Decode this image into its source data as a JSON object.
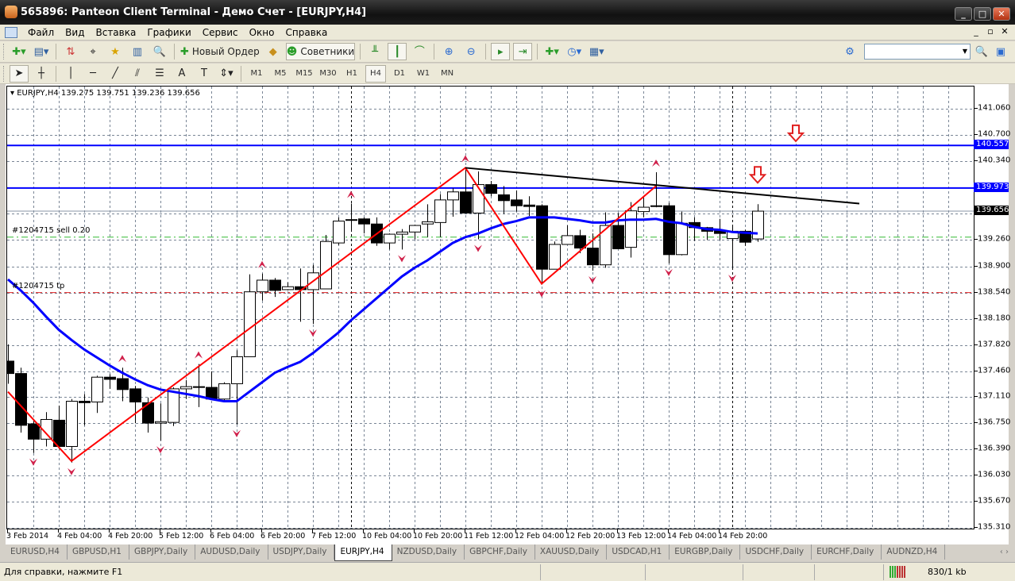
{
  "window": {
    "title": "565896: Panteon Client Terminal - Демо Счет - [EURJPY,H4]",
    "buttons": [
      "_",
      "□",
      "✕"
    ]
  },
  "menu": [
    "Файл",
    "Вид",
    "Вставка",
    "Графики",
    "Сервис",
    "Окно",
    "Справка"
  ],
  "mdi_buttons": [
    "_",
    "▫",
    "✕"
  ],
  "toolbar": {
    "new_order": "Новый Ордер",
    "experts": "Советники",
    "search_value": ""
  },
  "timeframes": [
    "M1",
    "M5",
    "M15",
    "M30",
    "H1",
    "H4",
    "D1",
    "W1",
    "MN"
  ],
  "active_timeframe": "H4",
  "chart": {
    "header": "EURJPY,H4  139.275 139.751 139.236 139.656",
    "order_label": "#1204715 sell 0.20",
    "tp_label": "#1204715 tp",
    "colors": {
      "bull": "#ffffff",
      "bear": "#000000",
      "ma": "#0000ff",
      "zigzag": "#ff0000",
      "level": "#0000ff",
      "fractal": "#d0204a"
    }
  },
  "chart_data": {
    "type": "candlestick",
    "symbol": "EURJPY",
    "timeframe": "H4",
    "ylim": [
      135.27,
      141.4
    ],
    "price_ticks": [
      "141.060",
      "140.700",
      "140.340",
      "139.260",
      "138.900",
      "138.540",
      "138.180",
      "137.820",
      "137.460",
      "137.110",
      "136.750",
      "136.390",
      "136.030",
      "135.670",
      "135.310"
    ],
    "grid_prices": [
      141.06,
      140.7,
      140.34,
      139.98,
      139.62,
      139.26,
      138.9,
      138.54,
      138.18,
      137.82,
      137.46,
      137.11,
      136.75,
      136.39,
      136.03,
      135.67,
      135.31
    ],
    "time_labels": [
      {
        "i": 0,
        "label": "3 Feb 2014"
      },
      {
        "i": 4,
        "label": "4 Feb 04:00"
      },
      {
        "i": 8,
        "label": "4 Feb 20:00"
      },
      {
        "i": 12,
        "label": "5 Feb 12:00"
      },
      {
        "i": 16,
        "label": "6 Feb 04:00"
      },
      {
        "i": 20,
        "label": "6 Feb 20:00"
      },
      {
        "i": 24,
        "label": "7 Feb 12:00"
      },
      {
        "i": 28,
        "label": "10 Feb 04:00"
      },
      {
        "i": 32,
        "label": "10 Feb 20:00"
      },
      {
        "i": 36,
        "label": "11 Feb 12:00"
      },
      {
        "i": 40,
        "label": "12 Feb 04:00"
      },
      {
        "i": 44,
        "label": "12 Feb 20:00"
      },
      {
        "i": 48,
        "label": "13 Feb 12:00"
      },
      {
        "i": 52,
        "label": "14 Feb 04:00"
      },
      {
        "i": 56,
        "label": "14 Feb 20:00"
      }
    ],
    "ohlc": [
      [
        137.6,
        137.83,
        137.29,
        137.43
      ],
      [
        137.43,
        137.51,
        136.62,
        136.72
      ],
      [
        136.74,
        136.8,
        136.34,
        136.53
      ],
      [
        136.53,
        136.9,
        136.43,
        136.8
      ],
      [
        136.79,
        136.99,
        136.42,
        136.43
      ],
      [
        136.43,
        137.08,
        136.21,
        137.05
      ],
      [
        137.05,
        137.15,
        136.72,
        137.03
      ],
      [
        137.04,
        137.4,
        136.89,
        137.38
      ],
      [
        137.38,
        137.42,
        137.22,
        137.35
      ],
      [
        137.36,
        137.51,
        137.05,
        137.21
      ],
      [
        137.22,
        137.26,
        136.75,
        137.04
      ],
      [
        137.03,
        137.1,
        136.62,
        136.75
      ],
      [
        136.75,
        137.02,
        136.51,
        136.77
      ],
      [
        136.76,
        137.24,
        136.71,
        137.22
      ],
      [
        137.22,
        137.34,
        137.08,
        137.25
      ],
      [
        137.25,
        137.56,
        136.97,
        137.24
      ],
      [
        137.24,
        137.46,
        137.08,
        137.08
      ],
      [
        137.08,
        137.31,
        137.05,
        137.29
      ],
      [
        137.29,
        137.75,
        136.73,
        137.66
      ],
      [
        137.66,
        138.79,
        137.66,
        138.55
      ],
      [
        138.55,
        138.8,
        138.43,
        138.71
      ],
      [
        138.71,
        138.74,
        138.48,
        138.57
      ],
      [
        138.58,
        138.68,
        138.57,
        138.62
      ],
      [
        138.62,
        138.87,
        138.14,
        138.58
      ],
      [
        138.58,
        138.92,
        138.11,
        138.81
      ],
      [
        138.59,
        139.33,
        138.59,
        139.24
      ],
      [
        139.22,
        139.57,
        139.19,
        139.52
      ],
      [
        139.54,
        139.76,
        139.4,
        139.54
      ],
      [
        139.55,
        139.57,
        139.35,
        139.48
      ],
      [
        139.48,
        139.57,
        139.18,
        139.22
      ],
      [
        139.22,
        139.35,
        139.13,
        139.34
      ],
      [
        139.34,
        139.41,
        139.13,
        139.37
      ],
      [
        139.37,
        139.47,
        139.27,
        139.46
      ],
      [
        139.48,
        139.75,
        139.3,
        139.51
      ],
      [
        139.5,
        139.89,
        139.3,
        139.81
      ],
      [
        139.81,
        139.97,
        139.58,
        139.92
      ],
      [
        139.92,
        140.25,
        139.63,
        139.63
      ],
      [
        139.63,
        140.2,
        139.27,
        140.02
      ],
      [
        140.02,
        140.07,
        139.86,
        139.9
      ],
      [
        139.88,
        140.0,
        139.62,
        139.8
      ],
      [
        139.81,
        139.94,
        139.65,
        139.73
      ],
      [
        139.74,
        139.86,
        139.59,
        139.72
      ],
      [
        139.73,
        139.75,
        138.65,
        138.86
      ],
      [
        138.86,
        139.24,
        138.86,
        139.2
      ],
      [
        139.2,
        139.46,
        139.2,
        139.32
      ],
      [
        139.32,
        139.4,
        139.08,
        139.15
      ],
      [
        139.15,
        139.35,
        138.84,
        138.92
      ],
      [
        138.92,
        139.64,
        138.88,
        139.46
      ],
      [
        139.46,
        139.63,
        139.14,
        139.14
      ],
      [
        139.16,
        139.78,
        139.02,
        139.66
      ],
      [
        139.65,
        139.84,
        139.57,
        139.71
      ],
      [
        139.73,
        140.19,
        139.71,
        139.72
      ],
      [
        139.73,
        139.77,
        138.94,
        139.06
      ],
      [
        139.06,
        139.65,
        139.05,
        139.49
      ],
      [
        139.5,
        139.57,
        139.25,
        139.43
      ],
      [
        139.43,
        139.44,
        139.26,
        139.38
      ],
      [
        139.39,
        139.55,
        139.26,
        139.35
      ],
      [
        139.28,
        139.46,
        138.86,
        139.38
      ],
      [
        139.38,
        139.4,
        139.18,
        139.23
      ],
      [
        139.275,
        139.751,
        139.236,
        139.656
      ]
    ],
    "moving_average": [
      138.72,
      138.57,
      138.4,
      138.21,
      138.03,
      137.89,
      137.76,
      137.65,
      137.54,
      137.44,
      137.35,
      137.27,
      137.21,
      137.18,
      137.15,
      137.12,
      137.08,
      137.05,
      137.05,
      137.18,
      137.31,
      137.44,
      137.52,
      137.59,
      137.71,
      137.85,
      137.99,
      138.16,
      138.31,
      138.46,
      138.61,
      138.76,
      138.88,
      138.98,
      139.1,
      139.22,
      139.3,
      139.35,
      139.42,
      139.48,
      139.52,
      139.57,
      139.57,
      139.57,
      139.55,
      139.53,
      139.5,
      139.5,
      139.53,
      139.54,
      139.54,
      139.55,
      139.51,
      139.49,
      139.44,
      139.41,
      139.4,
      139.37,
      139.36,
      139.35
    ],
    "zigzag": [
      [
        0,
        137.18
      ],
      [
        5,
        136.23
      ],
      [
        36,
        140.25
      ],
      [
        42,
        138.66
      ],
      [
        51,
        140.0
      ]
    ],
    "trendline": [
      [
        36,
        140.25
      ],
      [
        67,
        139.76
      ]
    ],
    "fractals_up": [
      9,
      15,
      20,
      27,
      36,
      51
    ],
    "fractals_down": [
      2,
      5,
      12,
      18,
      24,
      31,
      37,
      42,
      46,
      52,
      57
    ],
    "signal_arrows": [
      [
        62,
        140.68
      ],
      [
        59,
        140.11
      ]
    ],
    "levels": [
      {
        "price": 140.557,
        "label": "140.557"
      },
      {
        "price": 139.973,
        "label": "139.973"
      }
    ],
    "bid": {
      "price": 139.656,
      "label": "139.656"
    },
    "order_price": 139.3,
    "tp_price": 138.54,
    "period_separators": [
      27,
      57
    ]
  },
  "tabs": [
    "EURUSD,H4",
    "GBPUSD,H1",
    "GBPJPY,Daily",
    "AUDUSD,Daily",
    "USDJPY,Daily",
    "EURJPY,H4",
    "NZDUSD,Daily",
    "GBPCHF,Daily",
    "XAUUSD,Daily",
    "USDCAD,H1",
    "EURGBP,Daily",
    "USDCHF,Daily",
    "EURCHF,Daily",
    "AUDNZD,H4"
  ],
  "active_tab": "EURJPY,H4",
  "status": {
    "help": "Для справки, нажмите F1",
    "traffic": "830/1 kb"
  }
}
